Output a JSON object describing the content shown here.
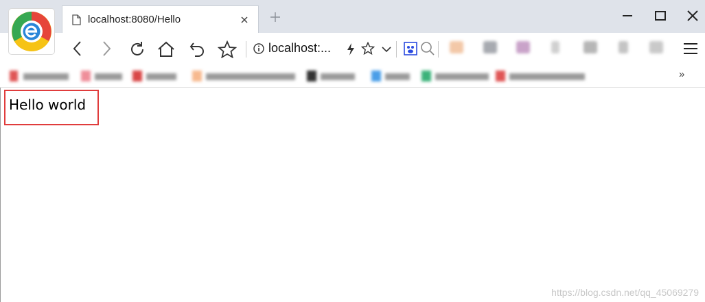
{
  "tab": {
    "title": "localhost:8080/Hello"
  },
  "address_bar": {
    "url": "localhost:..."
  },
  "bookmarks": {
    "more": "»"
  },
  "page": {
    "content": "Hello world"
  },
  "watermark": {
    "text": "https://blog.csdn.net/qq_45069279"
  },
  "colors": {
    "highlight_box": "#e03c3c",
    "tabstrip": "#dfe3ea"
  }
}
